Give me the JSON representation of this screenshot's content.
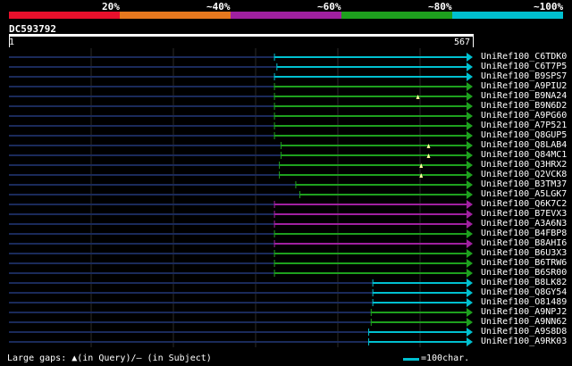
{
  "identity_scale": [
    {
      "label": "20%",
      "color": "#e8102c"
    },
    {
      "label": "~40%",
      "color": "#e6781e"
    },
    {
      "label": "~60%",
      "color": "#a020a0"
    },
    {
      "label": "~80%",
      "color": "#1ea01e"
    },
    {
      "label": "~100%",
      "color": "#00c0d0"
    }
  ],
  "query": {
    "id": "DC593792",
    "start": "1",
    "end": "567"
  },
  "hits": [
    {
      "name": "UniRef100_C6TDK0",
      "color": "#00c0d0",
      "start": 325,
      "end": 567
    },
    {
      "name": "UniRef100_C6T7P5",
      "color": "#00c0d0",
      "start": 328,
      "end": 567
    },
    {
      "name": "UniRef100_B9SPS7",
      "color": "#00c0d0",
      "start": 325,
      "end": 567
    },
    {
      "name": "UniRef100_A9PIU2",
      "color": "#1ea01e",
      "start": 325,
      "end": 567
    },
    {
      "name": "UniRef100_B9NA24",
      "color": "#1ea01e",
      "start": 325,
      "end": 567,
      "query_gap_at": 500
    },
    {
      "name": "UniRef100_B9N6D2",
      "color": "#1ea01e",
      "start": 325,
      "end": 567
    },
    {
      "name": "UniRef100_A9PG60",
      "color": "#1ea01e",
      "start": 325,
      "end": 567
    },
    {
      "name": "UniRef100_A7P521",
      "color": "#1ea01e",
      "start": 325,
      "end": 567
    },
    {
      "name": "UniRef100_Q8GUP5",
      "color": "#1ea01e",
      "start": 325,
      "end": 567
    },
    {
      "name": "UniRef100_Q8LAB4",
      "color": "#1ea01e",
      "start": 333,
      "end": 567,
      "query_gap_at": 513
    },
    {
      "name": "UniRef100_Q84MC1",
      "color": "#1ea01e",
      "start": 333,
      "end": 567,
      "query_gap_at": 513
    },
    {
      "name": "UniRef100_Q3HRX2",
      "color": "#1ea01e",
      "start": 331,
      "end": 567,
      "query_gap_at": 504
    },
    {
      "name": "UniRef100_Q2VCK8",
      "color": "#1ea01e",
      "start": 331,
      "end": 567,
      "query_gap_at": 504
    },
    {
      "name": "UniRef100_B3TM37",
      "color": "#1ea01e",
      "start": 351,
      "end": 567
    },
    {
      "name": "UniRef100_A5LGK7",
      "color": "#1ea01e",
      "start": 356,
      "end": 567
    },
    {
      "name": "UniRef100_Q6K7C2",
      "color": "#a020a0",
      "start": 325,
      "end": 567
    },
    {
      "name": "UniRef100_B7EVX3",
      "color": "#a020a0",
      "start": 325,
      "end": 567
    },
    {
      "name": "UniRef100_A3A6N3",
      "color": "#a020a0",
      "start": 325,
      "end": 567
    },
    {
      "name": "UniRef100_B4FBP8",
      "color": "#1ea01e",
      "start": 325,
      "end": 567
    },
    {
      "name": "UniRef100_B8AHI6",
      "color": "#a020a0",
      "start": 325,
      "end": 567
    },
    {
      "name": "UniRef100_B6U3X3",
      "color": "#1ea01e",
      "start": 325,
      "end": 567
    },
    {
      "name": "UniRef100_B6TRW6",
      "color": "#1ea01e",
      "start": 325,
      "end": 567
    },
    {
      "name": "UniRef100_B6SR00",
      "color": "#1ea01e",
      "start": 325,
      "end": 567
    },
    {
      "name": "UniRef100_B8LK82",
      "color": "#00c0d0",
      "start": 445,
      "end": 567
    },
    {
      "name": "UniRef100_Q8GY54",
      "color": "#00c0d0",
      "start": 445,
      "end": 567
    },
    {
      "name": "UniRef100_O81489",
      "color": "#00c0d0",
      "start": 445,
      "end": 567
    },
    {
      "name": "UniRef100_A9NPJ2",
      "color": "#1ea01e",
      "start": 443,
      "end": 567
    },
    {
      "name": "UniRef100_A9NN62",
      "color": "#1ea01e",
      "start": 443,
      "end": 567
    },
    {
      "name": "UniRef100_A9S8D8",
      "color": "#00c0d0",
      "start": 440,
      "end": 567
    },
    {
      "name": "UniRef100_A9RK03",
      "color": "#00c0d0",
      "start": 440,
      "end": 567
    }
  ],
  "legend": {
    "gaps_text": "Large gaps: ▲(in Query)/– (in Subject)",
    "scale_label": "=100char.",
    "scale_color": "#00c0d0"
  }
}
